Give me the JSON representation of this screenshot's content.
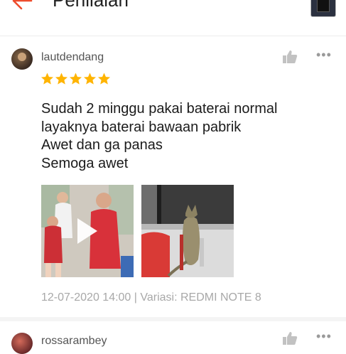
{
  "header": {
    "title": "Penilaian",
    "back_icon": "back-arrow-icon",
    "accent": "#ee4d2d"
  },
  "reviews": [
    {
      "username": "lautdendang",
      "rating": 5,
      "star_color": "#ffb400",
      "text": {
        "line1": "Sudah 2 minggu pakai baterai normal",
        "line2": "layaknya baterai bawaan pabrik",
        "line3": "Awet dan ga panas",
        "line4": "Semoga awet"
      },
      "media": [
        {
          "kind": "video",
          "icon": "play-icon"
        },
        {
          "kind": "photo"
        }
      ],
      "meta": "12-07-2020 14:00 | Variasi: REDMI NOTE 8"
    },
    {
      "username": "rossarambey"
    }
  ]
}
